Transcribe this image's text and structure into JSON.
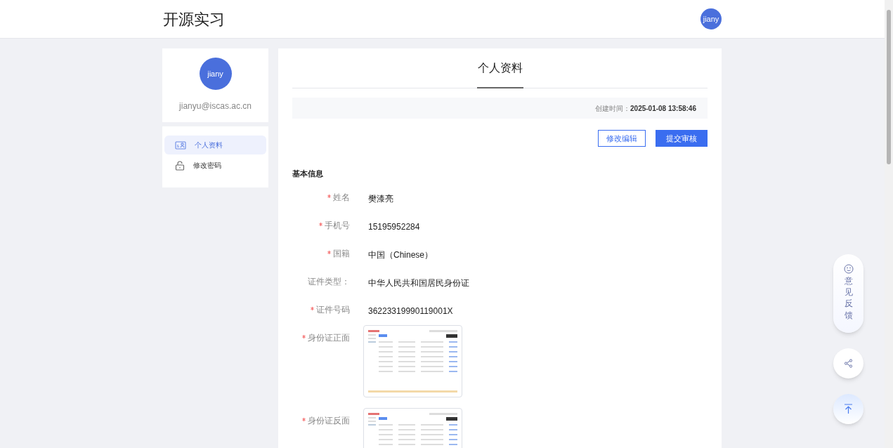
{
  "header": {
    "title": "开源实习",
    "avatar": "jiany"
  },
  "profile": {
    "avatar": "jiany",
    "email": "jianyu@iscas.ac.cn"
  },
  "sidebar": {
    "items": [
      {
        "label": "个人资料",
        "selected": true
      },
      {
        "label": "修改密码",
        "selected": false
      }
    ]
  },
  "main": {
    "title": "个人资料",
    "created_label": "创建时间：",
    "created_value": "2025-01-08 13:58:46",
    "buttons": [
      {
        "label": "修改编辑",
        "kind": "outline"
      },
      {
        "label": "提交审核",
        "kind": "primary"
      }
    ],
    "section_title": "基本信息",
    "fields": [
      {
        "label": "姓名",
        "required": true,
        "kind": "text",
        "value": "樊漆亮"
      },
      {
        "label": "手机号",
        "required": true,
        "kind": "text",
        "value": "15195952284"
      },
      {
        "label": "国籍",
        "required": true,
        "kind": "text",
        "value": "中国（Chinese）"
      },
      {
        "label": "证件类型：",
        "required": false,
        "kind": "text",
        "value": "中华人民共和国居民身份证"
      },
      {
        "label": "证件号码",
        "required": true,
        "kind": "text",
        "value": "36223319990119001X"
      },
      {
        "label": "身份证正面",
        "required": true,
        "kind": "image"
      },
      {
        "label": "身份证反面",
        "required": true,
        "kind": "image"
      }
    ]
  },
  "float": {
    "feedback": "意见反馈"
  }
}
